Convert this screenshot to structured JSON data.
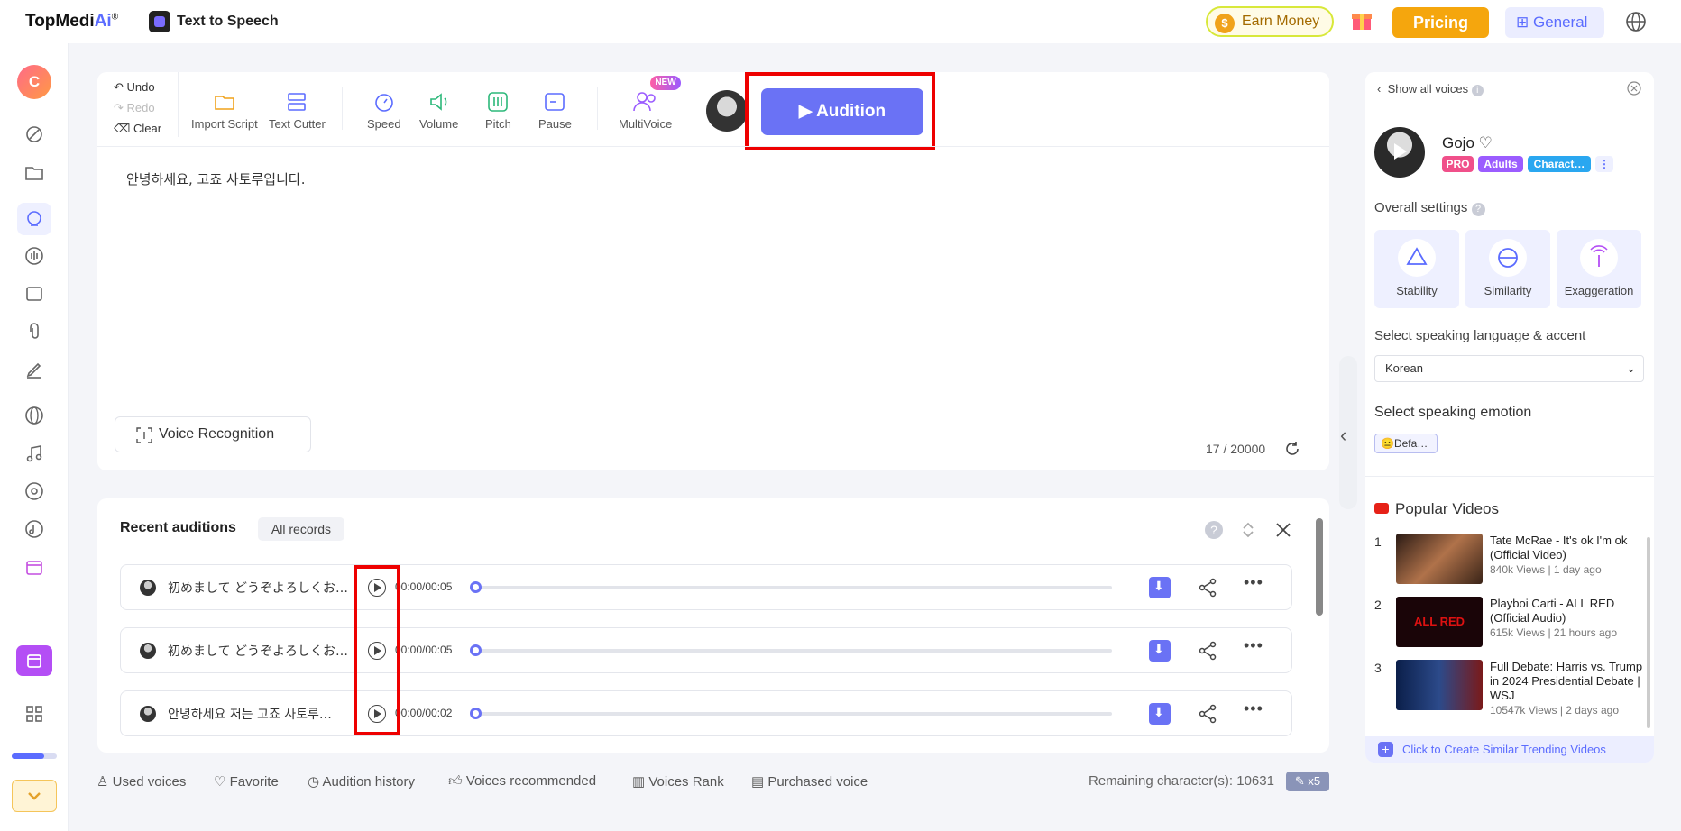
{
  "topbar": {
    "logo_main": "TopMedi",
    "logo_ai": "Ai",
    "logo_reg": "®",
    "app_name": "Text to Speech",
    "earn_money": "Earn Money",
    "pricing": "Pricing",
    "general": "General"
  },
  "toolbar": {
    "undo": "Undo",
    "redo": "Redo",
    "clear": "Clear",
    "import_script": "Import Script",
    "text_cutter": "Text Cutter",
    "speed": "Speed",
    "volume": "Volume",
    "pitch": "Pitch",
    "pause": "Pause",
    "multivoice": "MultiVoice",
    "new_badge": "NEW",
    "audition": "Audition"
  },
  "editor": {
    "text": "안녕하세요, 고죠 사토루입니다.",
    "voice_recognition": "Voice Recognition",
    "char_count": "17 / 20000"
  },
  "recent": {
    "title": "Recent auditions",
    "all_records": "All records",
    "rows": [
      {
        "text": "初めまして どうぞよろしくお…",
        "time": "00:00/00:05"
      },
      {
        "text": "初めまして どうぞよろしくお…",
        "time": "00:00/00:05"
      },
      {
        "text": "안녕하세요 저는 고죠 사토루…",
        "time": "00:00/00:02"
      }
    ]
  },
  "bottom": {
    "used_voices": "Used voices",
    "favorite": "Favorite",
    "audition_history": "Audition history",
    "voices_recommended": "Voices recommended",
    "voices_rank": "Voices Rank",
    "purchased_voice": "Purchased voice",
    "remaining": "Remaining character(s): 10631",
    "x5": "x5"
  },
  "right_panel": {
    "show_all": "Show all voices",
    "voice_name": "Gojo",
    "tags": [
      "PRO",
      "Adults",
      "Charact…"
    ],
    "overall_settings": "Overall settings",
    "settings": [
      "Stability",
      "Similarity",
      "Exaggeration"
    ],
    "language_label": "Select speaking language & accent",
    "language_value": "Korean",
    "emotion_label": "Select speaking emotion",
    "emotion_value": "Defa…",
    "popular_title": "Popular Videos",
    "videos": [
      {
        "num": "1",
        "title": "Tate McRae - It's ok I'm ok (Official Video)",
        "meta": "840k Views | 1 day ago"
      },
      {
        "num": "2",
        "title": "Playboi Carti - ALL RED (Official Audio)",
        "meta": "615k Views | 21 hours ago"
      },
      {
        "num": "3",
        "title": "Full Debate: Harris vs. Trump in 2024 Presidential Debate | WSJ",
        "meta": "10547k Views | 2 days ago"
      }
    ],
    "create_similar": "Click to Create Similar Trending Videos"
  },
  "colors": {
    "accent": "#6a72f5",
    "pricing": "#f5a60d",
    "highlight_box": "#e00000"
  }
}
